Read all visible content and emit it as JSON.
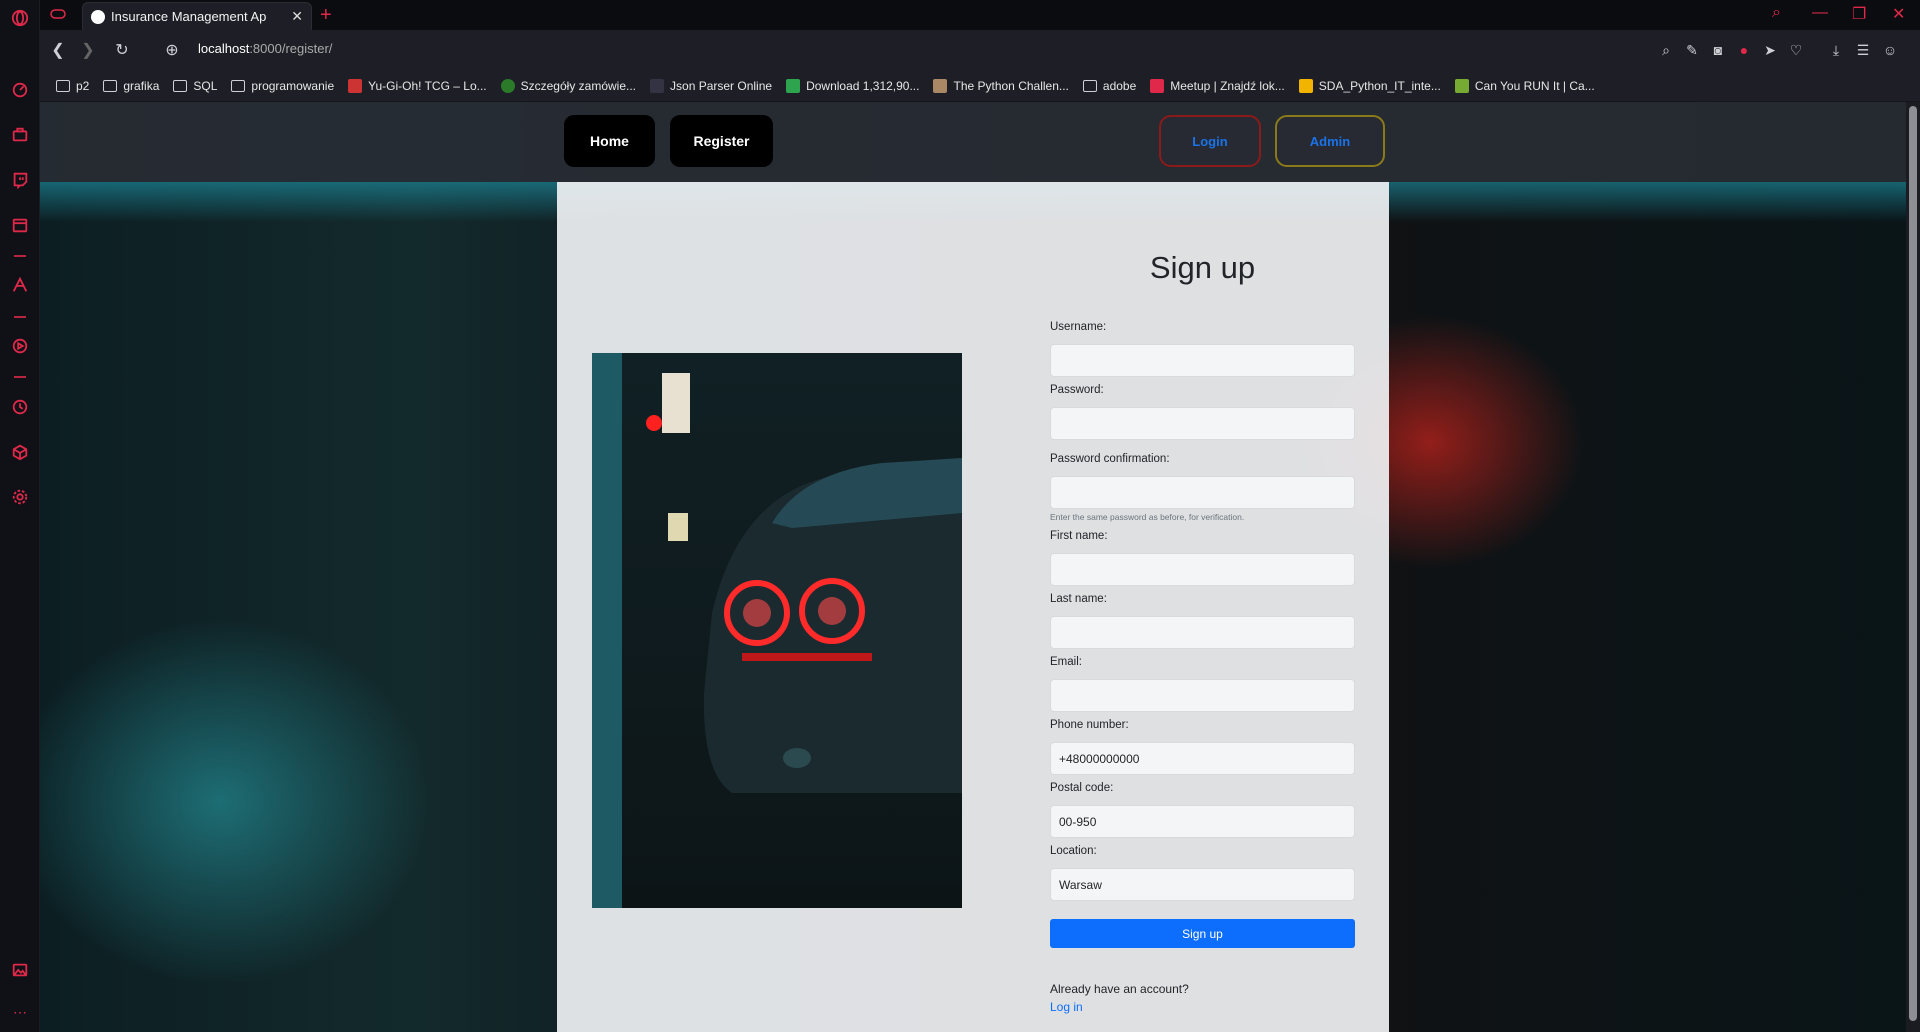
{
  "browser": {
    "tab_title": "Insurance Management Ap",
    "url_host": "localhost",
    "url_path": ":8000/register/"
  },
  "bookmarks": [
    {
      "label": "p2",
      "icon": "folder-icon"
    },
    {
      "label": "grafika",
      "icon": "folder-icon"
    },
    {
      "label": "SQL",
      "icon": "folder-icon"
    },
    {
      "label": "programowanie",
      "icon": "folder-icon"
    },
    {
      "label": "Yu-Gi-Oh! TCG – Lo...",
      "icon": "favicon"
    },
    {
      "label": "Szczegóły zamówie...",
      "icon": "favicon"
    },
    {
      "label": "Json Parser Online",
      "icon": "favicon"
    },
    {
      "label": "Download 1,312,90...",
      "icon": "favicon"
    },
    {
      "label": "The Python Challen...",
      "icon": "favicon"
    },
    {
      "label": "adobe",
      "icon": "folder-icon"
    },
    {
      "label": "Meetup | Znajdź lok...",
      "icon": "favicon"
    },
    {
      "label": "SDA_Python_IT_inte...",
      "icon": "favicon"
    },
    {
      "label": "Can You RUN It | Ca...",
      "icon": "favicon"
    }
  ],
  "navbar": {
    "home": "Home",
    "register": "Register",
    "login": "Login",
    "admin": "Admin"
  },
  "form": {
    "heading": "Sign up",
    "username_label": "Username:",
    "username_value": "",
    "password_label": "Password:",
    "password_value": "",
    "password_confirm_label": "Password confirmation:",
    "password_confirm_value": "",
    "password_help": "Enter the same password as before, for verification.",
    "first_name_label": "First name:",
    "first_name_value": "",
    "last_name_label": "Last name:",
    "last_name_value": "",
    "email_label": "Email:",
    "email_value": "",
    "phone_label": "Phone number:",
    "phone_value": "+48000000000",
    "postal_label": "Postal code:",
    "postal_value": "00-950",
    "location_label": "Location:",
    "location_value": "Warsaw",
    "submit": "Sign up",
    "already": "Already have an account?",
    "login_link": "Log in"
  },
  "colors": {
    "accent": "#e0294a",
    "primary_button": "#0d6efd",
    "login_border": "#8b1a1a",
    "admin_border": "#8a7a1a"
  }
}
